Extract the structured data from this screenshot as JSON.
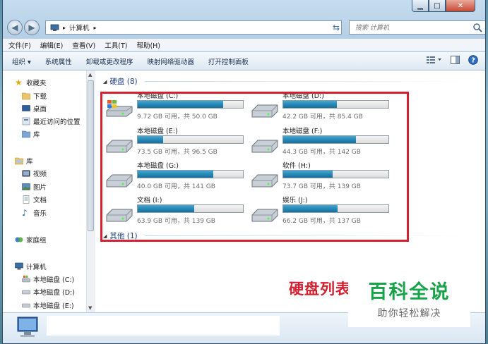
{
  "window": {
    "caption_min": "▁",
    "caption_max": "□",
    "caption_close": "✕"
  },
  "address": {
    "path_sep": "▸",
    "path_label": "计算机",
    "path_tail": "▸",
    "search_placeholder": "搜索 计算机"
  },
  "menu": [
    "文件(F)",
    "编辑(E)",
    "查看(V)",
    "工具(T)",
    "帮助(H)"
  ],
  "commands": {
    "organize": "组织 ▾",
    "items": [
      "系统属性",
      "卸载或更改程序",
      "映射网络驱动器",
      "打开控制面板"
    ]
  },
  "nav": {
    "favorites": "收藏夹",
    "fav_items": [
      "下载",
      "桌面",
      "最近访问的位置",
      "库"
    ],
    "libraries": "库",
    "lib_items": [
      "视频",
      "图片",
      "文档",
      "音乐"
    ],
    "homegroup": "家庭组",
    "computer": "计算机",
    "computer_items": [
      "本地磁盘 (C:)",
      "本地磁盘 (D:)",
      "本地磁盘 (E:)"
    ]
  },
  "groups": {
    "harddisk": "硬盘 (8)",
    "other": "其他 (1)"
  },
  "drives": [
    {
      "name": "本地磁盘 (C:)",
      "free": "9.72 GB 可用，共 50.0 GB",
      "used_fraction": 0.81,
      "system": true
    },
    {
      "name": "本地磁盘 (D:)",
      "free": "42.2 GB 可用，共 85.4 GB",
      "used_fraction": 0.51,
      "system": false
    },
    {
      "name": "本地磁盘 (E:)",
      "free": "73.5 GB 可用，共 96.5 GB",
      "used_fraction": 0.24,
      "system": false
    },
    {
      "name": "本地磁盘 (F:)",
      "free": "44.3 GB 可用，共 142 GB",
      "used_fraction": 0.69,
      "system": false
    },
    {
      "name": "本地磁盘 (G:)",
      "free": "40.0 GB 可用，共 141 GB",
      "used_fraction": 0.72,
      "system": false
    },
    {
      "name": "软件 (H:)",
      "free": "73.7 GB 可用，共 139 GB",
      "used_fraction": 0.47,
      "system": false
    },
    {
      "name": "文档 (I:)",
      "free": "63.9 GB 可用，共 139 GB",
      "used_fraction": 0.54,
      "system": false
    },
    {
      "name": "娱乐 (J:)",
      "free": "66.2 GB 可用，共 137 GB",
      "used_fraction": 0.52,
      "system": false
    }
  ],
  "annotation": "硬盘列表",
  "watermark": {
    "title": "百科全说",
    "subtitle": "助你轻松解决"
  },
  "colors": {
    "annotation_red": "#d4202f",
    "bar_blue": "#2789b7",
    "watermark_green": "#17a34a",
    "group_blue": "#1e3f86"
  }
}
